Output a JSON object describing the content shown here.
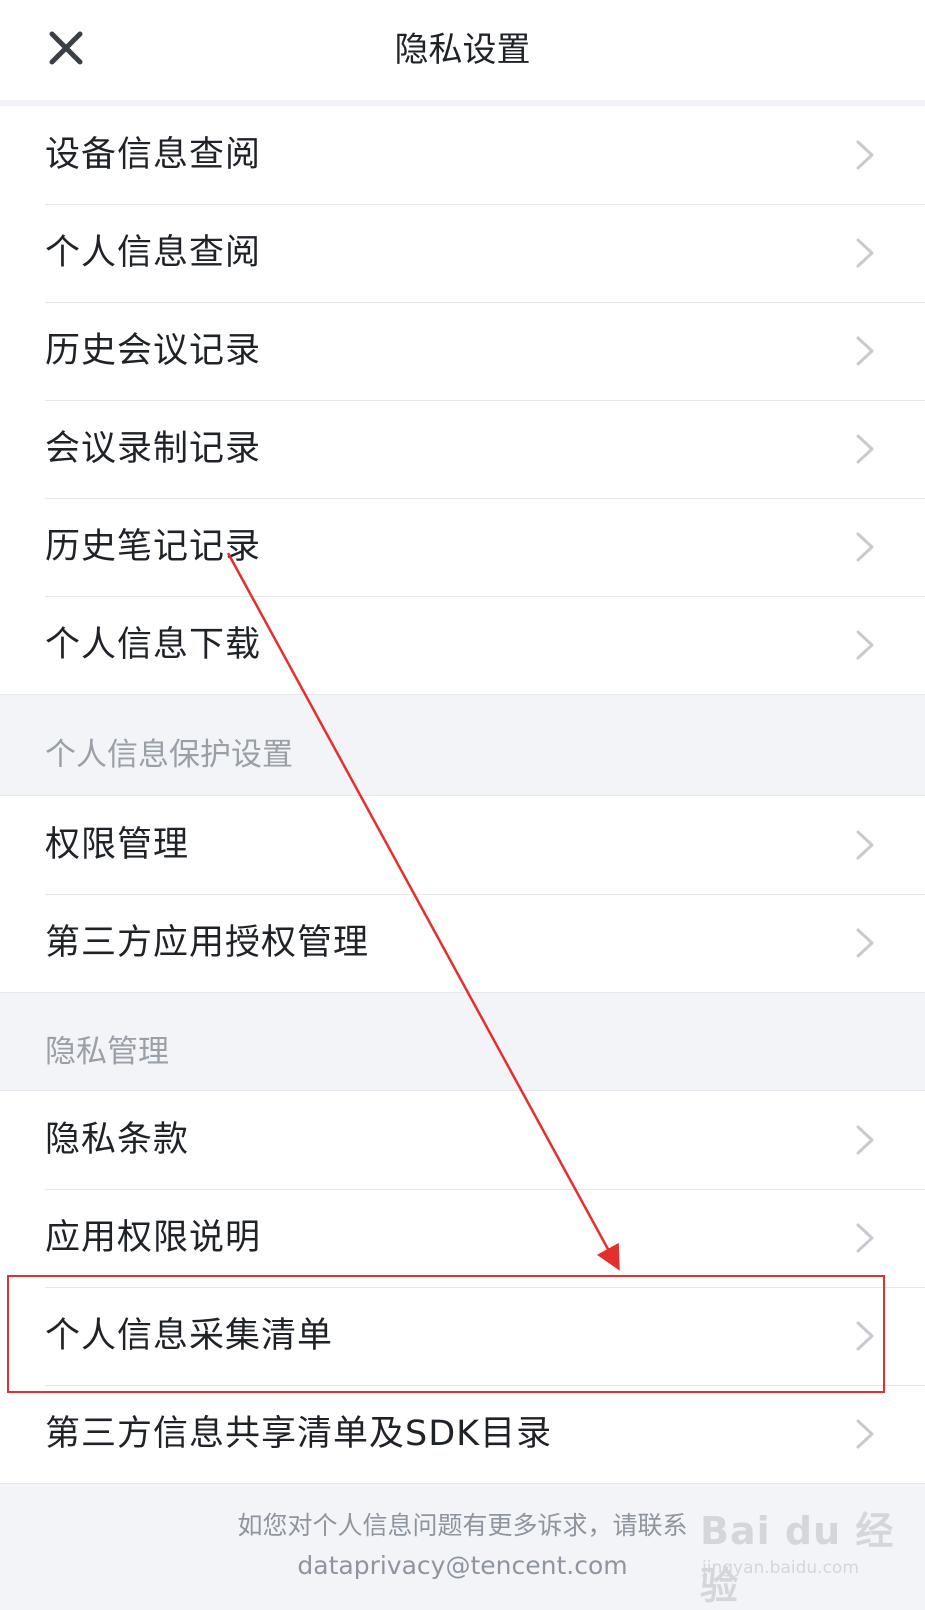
{
  "header": {
    "title": "隐私设置",
    "close_icon": "close-icon"
  },
  "groups": [
    {
      "header": "",
      "items": [
        {
          "label": "设备信息查阅"
        },
        {
          "label": "个人信息查阅"
        },
        {
          "label": "历史会议记录"
        },
        {
          "label": "会议录制记录"
        },
        {
          "label": "历史笔记记录"
        },
        {
          "label": "个人信息下载"
        }
      ]
    },
    {
      "header": "个人信息保护设置",
      "items": [
        {
          "label": "权限管理"
        },
        {
          "label": "第三方应用授权管理"
        }
      ]
    },
    {
      "header": "隐私管理",
      "items": [
        {
          "label": "隐私条款"
        },
        {
          "label": "应用权限说明"
        },
        {
          "label": "个人信息采集清单"
        },
        {
          "label": "第三方信息共享清单及SDK目录"
        }
      ]
    }
  ],
  "footer": {
    "line1": "如您对个人信息问题有更多诉求，请联系",
    "line2": "dataprivacy@tencent.com"
  },
  "watermark": {
    "logo": "Bai du 经验",
    "url": "jingyan.baidu.com"
  },
  "colors": {
    "annotation": "#e52e2e",
    "background": "#f3f4f8",
    "chevron": "#c7cacf",
    "secondary_text": "#9aa0a8"
  }
}
